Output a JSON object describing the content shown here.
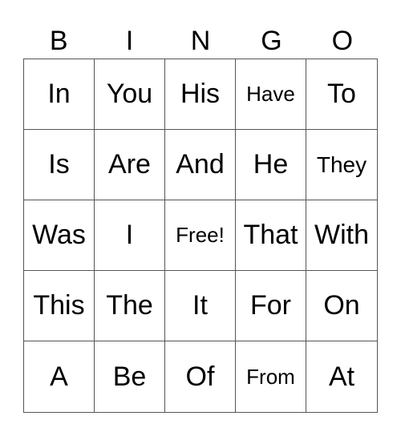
{
  "header": [
    "B",
    "I",
    "N",
    "G",
    "O"
  ],
  "cells": [
    [
      "In",
      "You",
      "His",
      "Have",
      "To"
    ],
    [
      "Is",
      "Are",
      "And",
      "He",
      "They"
    ],
    [
      "Was",
      "I",
      "Free!",
      "That",
      "With"
    ],
    [
      "This",
      "The",
      "It",
      "For",
      "On"
    ],
    [
      "A",
      "Be",
      "Of",
      "From",
      "At"
    ]
  ]
}
